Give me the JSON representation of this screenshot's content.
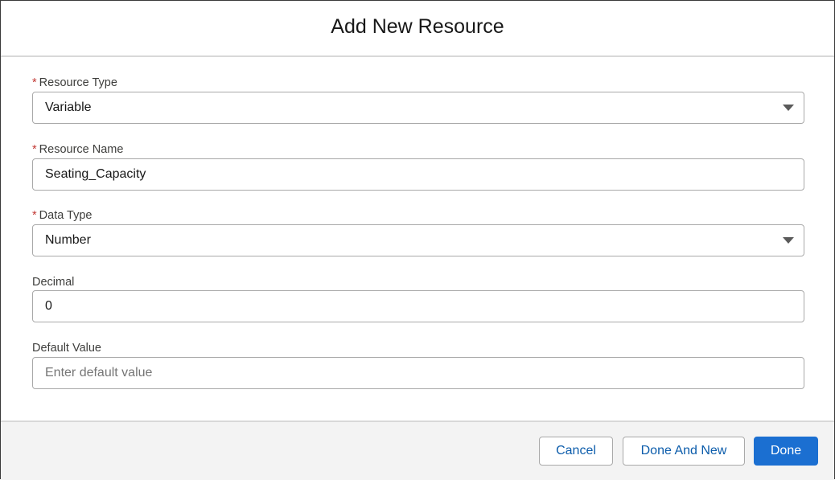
{
  "dialog": {
    "title": "Add New Resource"
  },
  "fields": {
    "resource_type": {
      "required_marker": "*",
      "label": "Resource Type",
      "value": "Variable",
      "control": "select"
    },
    "resource_name": {
      "required_marker": "*",
      "label": "Resource Name",
      "value": "Seating_Capacity",
      "control": "text"
    },
    "data_type": {
      "required_marker": "*",
      "label": "Data Type",
      "value": "Number",
      "control": "select"
    },
    "decimal": {
      "label": "Decimal",
      "value": "0",
      "control": "text"
    },
    "default_value": {
      "label": "Default Value",
      "value": "",
      "placeholder": "Enter default value",
      "control": "text"
    }
  },
  "footer": {
    "cancel_label": "Cancel",
    "done_and_new_label": "Done And New",
    "done_label": "Done"
  },
  "colors": {
    "required": "#c23934",
    "brand": "#1b6fd1",
    "link_text": "#0b5cab",
    "footer_bg": "#f3f3f3"
  },
  "icons": {
    "select_caret": "caret-down-icon"
  }
}
